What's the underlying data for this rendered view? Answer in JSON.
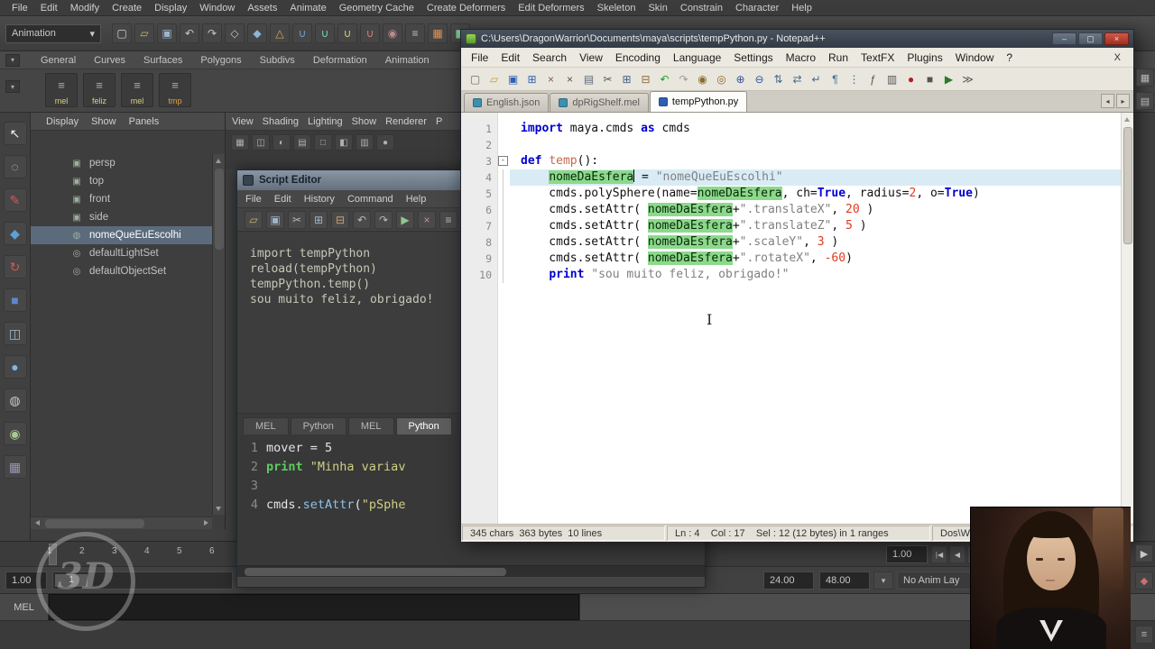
{
  "colors": {
    "npp_keyword": "#0000d0",
    "npp_string": "#808080",
    "npp_number": "#e03a1e",
    "smart_highlight": "#8cd98c",
    "current_line": "#d9ecf5",
    "outliner_selection": "#5b6b7b",
    "close_button": "#c0392b"
  },
  "watermark": {
    "text": "3D"
  },
  "maya": {
    "menubar": {
      "items": [
        "File",
        "Edit",
        "Modify",
        "Create",
        "Display",
        "Window",
        "Assets",
        "Animate",
        "Geometry Cache",
        "Create Deformers",
        "Edit Deformers",
        "Skeleton",
        "Skin",
        "Constrain",
        "Character",
        "Help"
      ]
    },
    "toolbar": {
      "mode": "Animation",
      "dropdown_arrow": "▾",
      "icons": [
        {
          "n": "new-scene-icon",
          "g": "▢",
          "c": "#d2d2d2"
        },
        {
          "n": "open-scene-icon",
          "g": "▱",
          "c": "#cfb870"
        },
        {
          "n": "save-scene-icon",
          "g": "▣",
          "c": "#9fb4cc"
        },
        {
          "n": "undo-icon",
          "g": "↶",
          "c": "#c6c6c6"
        },
        {
          "n": "redo-icon",
          "g": "↷",
          "c": "#c6c6c6"
        },
        {
          "n": "select-by-hierarchy-icon",
          "g": "◇",
          "c": "#b9c6d2"
        },
        {
          "n": "select-by-object-icon",
          "g": "◆",
          "c": "#8fb4d6"
        },
        {
          "n": "select-by-component-icon",
          "g": "△",
          "c": "#d2a964"
        },
        {
          "n": "snap-to-grid-icon",
          "g": "∪",
          "c": "#6fa0d8"
        },
        {
          "n": "snap-to-curve-icon",
          "g": "∪",
          "c": "#6fd8a8"
        },
        {
          "n": "snap-to-point-icon",
          "g": "∪",
          "c": "#d8d06f"
        },
        {
          "n": "snap-to-plane-icon",
          "g": "∪",
          "c": "#d87f6f"
        },
        {
          "n": "make-live-icon",
          "g": "◉",
          "c": "#c08a8a"
        },
        {
          "n": "construction-history-icon",
          "g": "≡",
          "c": "#bfbfbf"
        },
        {
          "n": "render-current-frame-icon",
          "g": "▦",
          "c": "#e0955a"
        },
        {
          "n": "ipr-render-icon",
          "g": "◧",
          "c": "#7fc890"
        }
      ]
    },
    "shelf": {
      "menu_glyph": "▾",
      "tabs": [
        "General",
        "Curves",
        "Surfaces",
        "Polygons",
        "Subdivs",
        "Deformation",
        "Animation"
      ],
      "items": [
        {
          "label": "mel",
          "glyph": "≡",
          "color": "#d8d080"
        },
        {
          "label": "feliz",
          "glyph": "≡",
          "color": "#d8d080"
        },
        {
          "label": "mel",
          "glyph": "≡",
          "color": "#d8d080"
        },
        {
          "label": "tmp",
          "glyph": "≡",
          "color": "#e0a040"
        }
      ]
    },
    "toolbox": {
      "icons": [
        {
          "n": "select-tool-icon",
          "g": "↖",
          "c": "#f0f0f0"
        },
        {
          "n": "lasso-tool-icon",
          "g": "◌",
          "c": "#d0d0d0"
        },
        {
          "n": "paint-select-tool-icon",
          "g": "✎",
          "c": "#d05858"
        },
        {
          "n": "move-tool-icon",
          "g": "◆",
          "c": "#5f9fd8"
        },
        {
          "n": "rotate-tool-icon",
          "g": "↻",
          "c": "#d05858"
        },
        {
          "n": "scale-tool-icon",
          "g": "■",
          "c": "#5f87c8"
        },
        {
          "n": "universal-manipulator-icon",
          "g": "◫",
          "c": "#9fb8d0"
        },
        {
          "n": "soft-modification-icon",
          "g": "●",
          "c": "#7fb8e8"
        },
        {
          "n": "show-manipulator-icon",
          "g": "◍",
          "c": "#c8c8c8"
        },
        {
          "n": "last-tool-icon",
          "g": "◉",
          "c": "#a8c890"
        },
        {
          "n": "layout-shortcut-icon",
          "g": "▦",
          "c": "#9898b8"
        }
      ]
    },
    "outliner": {
      "menu": [
        "Display",
        "Show",
        "Panels"
      ],
      "items": [
        {
          "label": "persp",
          "icon": "camera-icon",
          "glyph": "▣"
        },
        {
          "label": "top",
          "icon": "camera-icon",
          "glyph": "▣"
        },
        {
          "label": "front",
          "icon": "camera-icon",
          "glyph": "▣"
        },
        {
          "label": "side",
          "icon": "camera-icon",
          "glyph": "▣"
        },
        {
          "label": "nomeQueEuEscolhi",
          "icon": "mesh-icon",
          "glyph": "◍",
          "selected": true
        },
        {
          "label": "defaultLightSet",
          "icon": "set-icon",
          "glyph": "◎"
        },
        {
          "label": "defaultObjectSet",
          "icon": "set-icon",
          "glyph": "◎"
        }
      ]
    },
    "viewport": {
      "menu": [
        "View",
        "Shading",
        "Lighting",
        "Show",
        "Renderer",
        "P"
      ],
      "icons": [
        {
          "n": "viewport-grid-icon",
          "g": "▦",
          "c": "#b0b0b0"
        },
        {
          "n": "viewport-film-gate-icon",
          "g": "◫",
          "c": "#b0b0b0"
        },
        {
          "n": "viewport-gate-mask-icon",
          "g": "◐",
          "c": "#b0b0b0"
        },
        {
          "n": "viewport-field-chart-icon",
          "g": "▤",
          "c": "#b0b0b0"
        },
        {
          "n": "viewport-safe-action-icon",
          "g": "□",
          "c": "#b0b0b0"
        },
        {
          "n": "viewport-safe-title-icon",
          "g": "◧",
          "c": "#b0b0b0"
        },
        {
          "n": "viewport-resolution-icon",
          "g": "▥",
          "c": "#b0b0b0"
        },
        {
          "n": "viewport-shading-icon",
          "g": "●",
          "c": "#b0b0b0"
        }
      ]
    },
    "script_editor": {
      "title": "Script Editor",
      "menu": [
        "File",
        "Edit",
        "History",
        "Command",
        "Help"
      ],
      "toolbar_icons": [
        {
          "n": "open-script-icon",
          "g": "▱",
          "c": "#c8b070"
        },
        {
          "n": "save-script-icon",
          "g": "▣",
          "c": "#9fb4cc"
        },
        {
          "n": "cut-icon",
          "g": "✂",
          "c": "#bbbbbb"
        },
        {
          "n": "copy-icon",
          "g": "⊞",
          "c": "#9fb4cc"
        },
        {
          "n": "paste-icon",
          "g": "⊟",
          "c": "#c8a070"
        },
        {
          "n": "undo-icon",
          "g": "↶",
          "c": "#bbbbbb"
        },
        {
          "n": "redo-icon",
          "g": "↷",
          "c": "#bbbbbb"
        },
        {
          "n": "execute-all-icon",
          "g": "▶",
          "c": "#8fc88f"
        },
        {
          "n": "clear-history-icon",
          "g": "×",
          "c": "#c88f8f"
        },
        {
          "n": "show-line-numbers-icon",
          "g": "≡",
          "c": "#bbbbbb"
        }
      ],
      "output_lines": [
        "import tempPython",
        "reload(tempPython)",
        "tempPython.temp()",
        "sou muito feliz, obrigado!"
      ],
      "tabs": [
        {
          "label": "MEL"
        },
        {
          "label": "Python"
        },
        {
          "label": "MEL"
        },
        {
          "label": "Python",
          "active": true
        }
      ],
      "lines": [
        {
          "n": "1",
          "tokens": [
            [
              "pl",
              "mover = 5"
            ]
          ]
        },
        {
          "n": "2",
          "tokens": [
            [
              "kw",
              "print"
            ],
            [
              "pl",
              " "
            ],
            [
              "str",
              "\"Minha variav"
            ]
          ]
        },
        {
          "n": "3",
          "tokens": []
        },
        {
          "n": "4",
          "tokens": [
            [
              "pl",
              "cmds."
            ],
            [
              "fn",
              "setAttr"
            ],
            [
              "pl",
              "("
            ],
            [
              "str",
              "\"pSphe"
            ]
          ]
        }
      ]
    },
    "timeline": {
      "ticks": [
        "1",
        "2",
        "3",
        "4",
        "5",
        "6"
      ],
      "current_time": "1.00"
    },
    "range": {
      "start": "1.00",
      "handle": "1",
      "end_a": "24.00",
      "end_b": "48.00",
      "layer_dropdown": "▾",
      "anim_layer": "No Anim Lay"
    },
    "command_line": {
      "label": "MEL"
    },
    "playback_icons": [
      {
        "n": "go-to-start-button",
        "g": "|◀",
        "c": "#c8c8c8"
      },
      {
        "n": "step-back-button",
        "g": "◀",
        "c": "#c8c8c8"
      },
      {
        "n": "step-forward-button",
        "g": "▶",
        "c": "#c8c8c8"
      }
    ],
    "right_side_icons": [
      {
        "n": "channel-box-toggle-icon",
        "g": "▦",
        "c": "#b8b8b8"
      },
      {
        "n": "attribute-editor-toggle-icon",
        "g": "▤",
        "c": "#b8b8b8"
      }
    ],
    "right_edge_icons": [
      {
        "n": "play-button",
        "g": "▶",
        "c": "#c8c8c8"
      },
      {
        "n": "auto-keyframe-icon",
        "g": "◆",
        "c": "#c87070"
      },
      {
        "n": "animation-preferences-icon",
        "g": "≡",
        "c": "#b8b8b8"
      }
    ]
  },
  "npp": {
    "title": "C:\\Users\\DragonWarrior\\Documents\\maya\\scripts\\tempPython.py - Notepad++",
    "cursor_glyph": "I",
    "window_buttons": [
      {
        "name": "minimize-button",
        "glyph": "–"
      },
      {
        "name": "maximize-button",
        "glyph": "▢"
      },
      {
        "name": "close-button",
        "glyph": "×"
      }
    ],
    "menu": {
      "items": [
        "File",
        "Edit",
        "Search",
        "View",
        "Encoding",
        "Language",
        "Settings",
        "Macro",
        "Run",
        "TextFX",
        "Plugins",
        "Window",
        "?"
      ],
      "close": "X"
    },
    "toolbar_icons": [
      {
        "n": "new-file-icon",
        "g": "▢",
        "c": "#6b6b6b"
      },
      {
        "n": "open-folder-icon",
        "g": "▱",
        "c": "#c89a2a"
      },
      {
        "n": "save-icon",
        "g": "▣",
        "c": "#2f5fb0"
      },
      {
        "n": "save-all-icon",
        "g": "⊞",
        "c": "#2f5fb0"
      },
      {
        "n": "close-doc-icon",
        "g": "×",
        "c": "#8a5a4a"
      },
      {
        "n": "close-all-icon",
        "g": "×",
        "c": "#6a4a3a"
      },
      {
        "n": "print-icon",
        "g": "▤",
        "c": "#5a6a7a"
      },
      {
        "n": "cut-icon",
        "g": "✂",
        "c": "#555555"
      },
      {
        "n": "copy-icon",
        "g": "⊞",
        "c": "#44608a"
      },
      {
        "n": "paste-icon",
        "g": "⊟",
        "c": "#8a6a3a"
      },
      {
        "n": "undo-icon",
        "g": "↶",
        "c": "#2a9a2a"
      },
      {
        "n": "redo-icon",
        "g": "↷",
        "c": "#9a9a9a"
      },
      {
        "n": "find-icon",
        "g": "◉",
        "c": "#8a6a2a"
      },
      {
        "n": "replace-icon",
        "g": "◎",
        "c": "#8a6a2a"
      },
      {
        "n": "zoom-in-icon",
        "g": "⊕",
        "c": "#33549a"
      },
      {
        "n": "zoom-out-icon",
        "g": "⊖",
        "c": "#33549a"
      },
      {
        "n": "sync-vertical-icon",
        "g": "⇅",
        "c": "#4a6a8a"
      },
      {
        "n": "sync-horizontal-icon",
        "g": "⇄",
        "c": "#4a6a8a"
      },
      {
        "n": "word-wrap-icon",
        "g": "↵",
        "c": "#3a6a9a"
      },
      {
        "n": "show-all-chars-icon",
        "g": "¶",
        "c": "#3a6a9a"
      },
      {
        "n": "indent-guide-icon",
        "g": "⋮",
        "c": "#3a6a9a"
      },
      {
        "n": "function-list-icon",
        "g": "ƒ",
        "c": "#555555"
      },
      {
        "n": "doc-map-icon",
        "g": "▥",
        "c": "#555555"
      },
      {
        "n": "record-macro-icon",
        "g": "●",
        "c": "#b02020"
      },
      {
        "n": "stop-macro-icon",
        "g": "■",
        "c": "#555555"
      },
      {
        "n": "play-macro-icon",
        "g": "▶",
        "c": "#2a7a2a"
      },
      {
        "n": "run-multi-macro-icon",
        "g": "≫",
        "c": "#555555"
      }
    ],
    "tabs": [
      {
        "label": "English.json"
      },
      {
        "label": "dpRigShelf.mel"
      },
      {
        "label": "tempPython.py",
        "active": true
      }
    ],
    "tab_scroll": {
      "left": "◂",
      "right": "▸"
    },
    "editor": {
      "lines": [
        {
          "n": "1",
          "tokens": [
            [
              "kw",
              "import"
            ],
            [
              "pl",
              " maya.cmds "
            ],
            [
              "kw",
              "as"
            ],
            [
              "pl",
              " cmds"
            ]
          ]
        },
        {
          "n": "2",
          "tokens": []
        },
        {
          "n": "3",
          "fold": "-",
          "tokens": [
            [
              "kw",
              "def"
            ],
            [
              "pl",
              " "
            ],
            [
              "fn",
              "temp"
            ],
            [
              "pl",
              "():"
            ]
          ]
        },
        {
          "n": "4",
          "current": true,
          "guide": true,
          "tokens": [
            [
              "pl",
              "    "
            ],
            [
              "hl",
              "nomeDaEsfera"
            ],
            [
              "caret",
              ""
            ],
            [
              "pl",
              " = "
            ],
            [
              "str",
              "\"nomeQueEuEscolhi\""
            ]
          ]
        },
        {
          "n": "5",
          "guide": true,
          "tokens": [
            [
              "pl",
              "    cmds.polySphere(name="
            ],
            [
              "hl",
              "nomeDaEsfera"
            ],
            [
              "pl",
              ", ch="
            ],
            [
              "kw",
              "True"
            ],
            [
              "pl",
              ", radius="
            ],
            [
              "num",
              "2"
            ],
            [
              "pl",
              ", o="
            ],
            [
              "kw",
              "True"
            ],
            [
              "pl",
              ")"
            ]
          ]
        },
        {
          "n": "6",
          "guide": true,
          "tokens": [
            [
              "pl",
              "    cmds.setAttr( "
            ],
            [
              "hl",
              "nomeDaEsfera"
            ],
            [
              "pl",
              "+"
            ],
            [
              "str",
              "\".translateX\""
            ],
            [
              "pl",
              ", "
            ],
            [
              "num",
              "20"
            ],
            [
              "pl",
              " )"
            ]
          ]
        },
        {
          "n": "7",
          "guide": true,
          "tokens": [
            [
              "pl",
              "    cmds.setAttr( "
            ],
            [
              "hl",
              "nomeDaEsfera"
            ],
            [
              "pl",
              "+"
            ],
            [
              "str",
              "\".translateZ\""
            ],
            [
              "pl",
              ", "
            ],
            [
              "num",
              "5"
            ],
            [
              "pl",
              " )"
            ]
          ]
        },
        {
          "n": "8",
          "guide": true,
          "tokens": [
            [
              "pl",
              "    cmds.setAttr( "
            ],
            [
              "hl",
              "nomeDaEsfera"
            ],
            [
              "pl",
              "+"
            ],
            [
              "str",
              "\".scaleY\""
            ],
            [
              "pl",
              ", "
            ],
            [
              "num",
              "3"
            ],
            [
              "pl",
              " )"
            ]
          ]
        },
        {
          "n": "9",
          "guide": true,
          "tokens": [
            [
              "pl",
              "    cmds.setAttr( "
            ],
            [
              "hl",
              "nomeDaEsfera"
            ],
            [
              "pl",
              "+"
            ],
            [
              "str",
              "\".rotateX\""
            ],
            [
              "pl",
              ", "
            ],
            [
              "num",
              "-60"
            ],
            [
              "pl",
              ")"
            ]
          ]
        },
        {
          "n": "10",
          "guide": true,
          "tokens": [
            [
              "pl",
              "    "
            ],
            [
              "kw",
              "print"
            ],
            [
              "pl",
              " "
            ],
            [
              "str",
              "\"sou muito feliz, obrigado!\""
            ]
          ]
        }
      ]
    },
    "status": {
      "doc": "345 chars  363 bytes  10 lines",
      "position": "Ln : 4    Col : 17    Sel : 12 (12 bytes) in 1 ranges",
      "format": "Dos\\W"
    }
  }
}
